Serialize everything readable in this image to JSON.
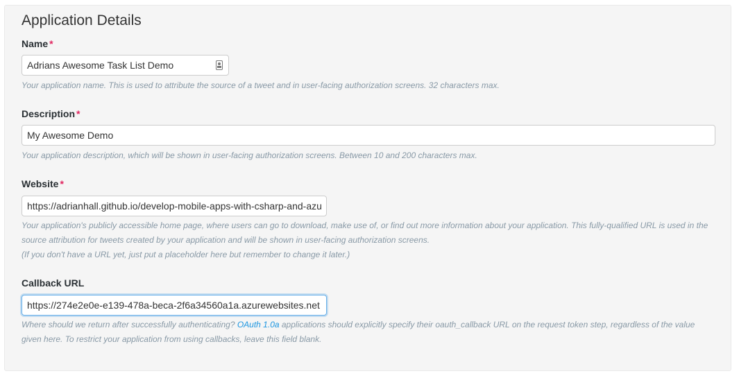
{
  "section_title": "Application Details",
  "required_marker": "*",
  "name": {
    "label": "Name",
    "value": "Adrians Awesome Task List Demo",
    "help": "Your application name. This is used to attribute the source of a tweet and in user-facing authorization screens. 32 characters max."
  },
  "description": {
    "label": "Description",
    "value": "My Awesome Demo",
    "help": "Your application description, which will be shown in user-facing authorization screens. Between 10 and 200 characters max."
  },
  "website": {
    "label": "Website",
    "value": "https://adrianhall.github.io/develop-mobile-apps-with-csharp-and-azure",
    "help_line1": "Your application's publicly accessible home page, where users can go to download, make use of, or find out more information about your application. This fully-qualified URL is used in the",
    "help_line2": "source attribution for tweets created by your application and will be shown in user-facing authorization screens.",
    "help_line3": "(If you don't have a URL yet, just put a placeholder here but remember to change it later.)"
  },
  "callback": {
    "label": "Callback URL",
    "value": "https://274e2e0e-e139-478a-beca-2f6a34560a1a.azurewebsites.net",
    "help_before_link": "Where should we return after successfully authenticating? ",
    "help_link": "OAuth 1.0a",
    "help_after_link": " applications should explicitly specify their oauth_callback URL on the request token step, regardless of the value",
    "help_line2": "given here. To restrict your application from using callbacks, leave this field blank."
  },
  "colors": {
    "panel_bg": "#f5f5f5",
    "required": "#e0245e",
    "link": "#1b95e0",
    "help_text": "#8899a6",
    "focus_border": "#66afe9"
  },
  "icons": {
    "name_field_icon": "contact-card-icon"
  }
}
